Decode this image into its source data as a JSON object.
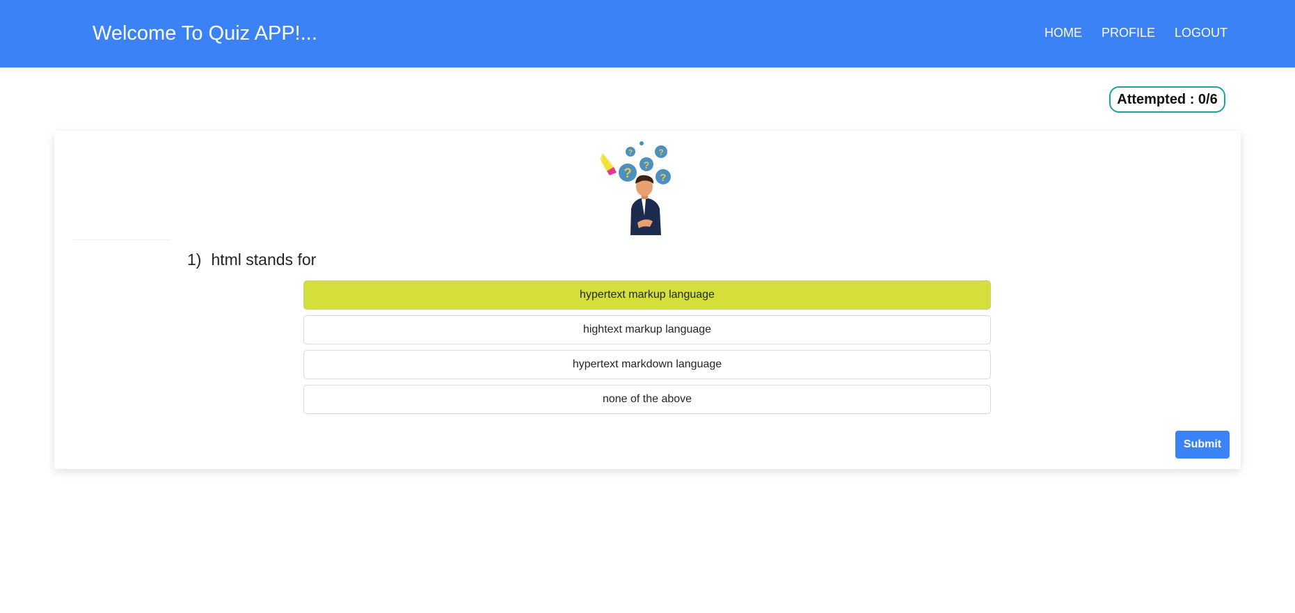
{
  "navbar": {
    "brand": "Welcome To Quiz APP!...",
    "links": [
      {
        "label": "HOME"
      },
      {
        "label": "PROFILE"
      },
      {
        "label": "LOGOUT"
      }
    ],
    "background_color": "#3b82f6"
  },
  "progress": {
    "label": "Attempted : 0/6",
    "attempted": 0,
    "total": 6
  },
  "question": {
    "number": "1)",
    "text": "html stands for",
    "illustration_icon": "thinking-person-icon",
    "options": [
      {
        "label": "hypertext markup language",
        "selected": true
      },
      {
        "label": "hightext markup language",
        "selected": false
      },
      {
        "label": "hypertext markdown language",
        "selected": false
      },
      {
        "label": "none of the above",
        "selected": false
      }
    ],
    "selected_color": "#d4df3c"
  },
  "actions": {
    "submit_label": "Submit"
  }
}
